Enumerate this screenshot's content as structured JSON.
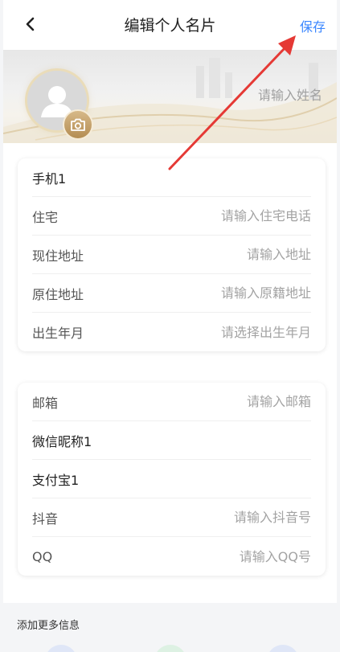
{
  "header": {
    "title": "编辑个人名片",
    "save_label": "保存",
    "back_icon": "chevron-left-icon"
  },
  "profile": {
    "name_placeholder": "请输入姓名",
    "avatar_icon": "user-avatar-icon",
    "camera_icon": "camera-icon"
  },
  "contact_card": {
    "rows": [
      {
        "label": "手机1",
        "value": "",
        "placeholder": ""
      },
      {
        "label": "住宅",
        "value": "",
        "placeholder": "请输入住宅电话"
      },
      {
        "label": "现住地址",
        "value": "",
        "placeholder": "请输入地址"
      },
      {
        "label": "原住地址",
        "value": "",
        "placeholder": "请输入原籍地址"
      },
      {
        "label": "出生年月",
        "value": "",
        "placeholder": "请选择出生年月"
      }
    ]
  },
  "social_card": {
    "rows": [
      {
        "label": "邮箱",
        "value": "",
        "placeholder": "请输入邮箱"
      },
      {
        "label": "微信昵称1",
        "value": "",
        "placeholder": ""
      },
      {
        "label": "支付宝1",
        "value": "",
        "placeholder": ""
      },
      {
        "label": "抖音",
        "value": "",
        "placeholder": "请输入抖音号"
      },
      {
        "label": "QQ",
        "value": "",
        "placeholder": "请输入QQ号"
      }
    ]
  },
  "more": {
    "title": "添加更多信息"
  },
  "colors": {
    "accent": "#3a86ff",
    "annotation_arrow": "#e53935",
    "camera_badge": "#c4a06a"
  }
}
